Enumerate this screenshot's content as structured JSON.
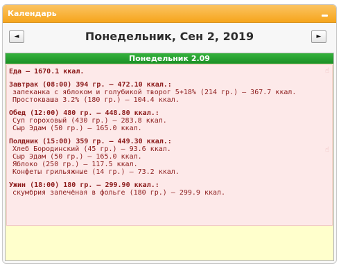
{
  "widget": {
    "title": "Календарь",
    "collapse_icon": "minus-icon"
  },
  "nav": {
    "prev_glyph": "◄",
    "next_glyph": "►",
    "date_title": "Понедельник, Сен 2, 2019"
  },
  "day": {
    "header": "Понедельник 2.09",
    "total": "Еда — 1670.1 ккал.",
    "meals": [
      {
        "header": "Завтрак (08:00) 394 гр. — 472.10 ккал.:",
        "items": [
          "запеканка с яблоком и голубикой творог 5+18% (214 гр.) — 367.7 ккал.",
          "Простокваша 3.2% (180 гр.) — 104.4 ккал."
        ]
      },
      {
        "header": "Обед (12:00) 480 гр. — 448.80 ккал.:",
        "items": [
          "Суп гороховый (430 гр.) — 283.8 ккал.",
          "Сыр Эдам (50 гр.) — 165.0 ккал."
        ]
      },
      {
        "header": "Полдник (15:00) 359 гр. — 449.30 ккал.:",
        "items": [
          "Хлеб Бородинский (45 гр.) — 93.6 ккал.",
          "Сыр Эдам (50 гр.) — 165.0 ккал.",
          "Яблоко (250 гр.) — 117.5 ккал.",
          "Конфеты грильяжные (14 гр.) — 73.2 ккал."
        ]
      },
      {
        "header": "Ужин (18:00) 180 гр. — 299.90 ккал.:",
        "items": [
          "скумбрия запечёная в фольге (180 гр.) — 299.9 ккал."
        ]
      }
    ]
  },
  "icons": {
    "hand_glyph": "☝"
  }
}
